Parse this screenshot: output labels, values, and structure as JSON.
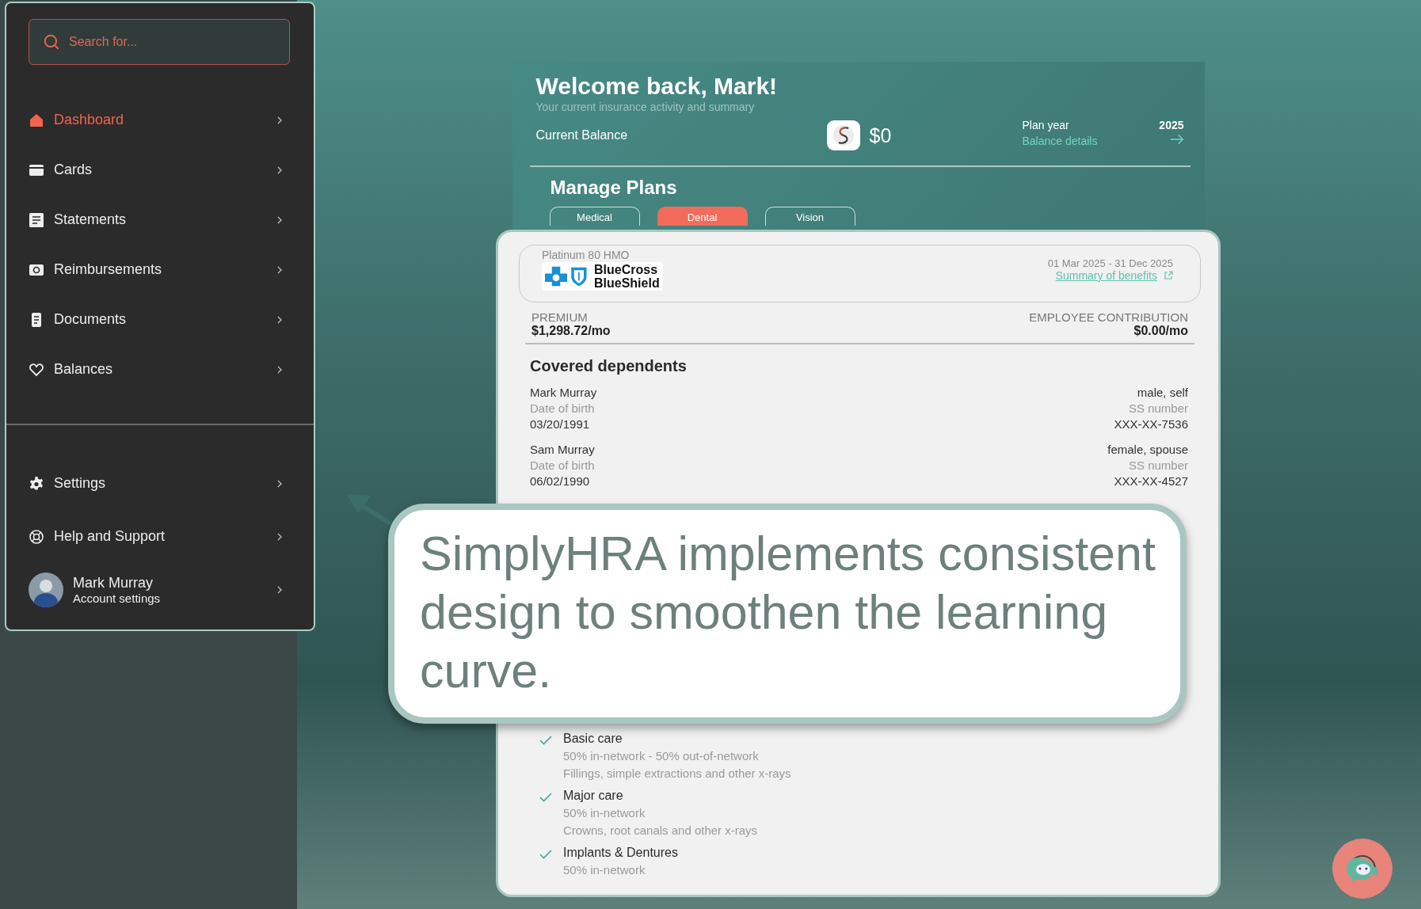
{
  "sidebar": {
    "search": {
      "placeholder": "Search for..."
    },
    "items": [
      {
        "label": "Dashboard",
        "selected": true
      },
      {
        "label": "Cards",
        "selected": false
      },
      {
        "label": "Statements",
        "selected": false
      },
      {
        "label": "Reimbursements",
        "selected": false
      },
      {
        "label": "Documents",
        "selected": false
      },
      {
        "label": "Balances",
        "selected": false
      }
    ],
    "bottom_items": [
      {
        "label": "Settings",
        "selected": false
      },
      {
        "label": "Help and Support",
        "selected": false
      }
    ],
    "user": {
      "name": "Mark Murray",
      "subtitle": "Account settings"
    }
  },
  "header": {
    "title": "Welcome back, Mark!",
    "subtitle": "Your current insurance activity and summary",
    "balance_label": "Current Balance",
    "balance": "$0",
    "plan_year_label": "Plan year",
    "plan_year": "2025",
    "balance_details": "Balance details"
  },
  "manage_plans": {
    "title": "Manage Plans",
    "tabs": [
      {
        "label": "Medical",
        "selected": false
      },
      {
        "label": "Dental",
        "selected": true
      },
      {
        "label": "Vision",
        "selected": false
      }
    ]
  },
  "plan": {
    "name": "Platinum 80 HMO",
    "insurer": [
      "BlueCross",
      "BlueShield"
    ],
    "dates": "01 Mar 2025 - 31 Dec 2025",
    "benefits_link": "Summary of benefits",
    "premium_label": "PREMIUM",
    "premium": "$1,298.72/mo",
    "contribution_label": "EMPLOYEE CONTRIBUTION",
    "contribution": "$0.00/mo"
  },
  "dependents": {
    "title": "Covered dependents",
    "people": [
      {
        "name": "Mark Murray",
        "dob_label": "Date of birth",
        "dob": "03/20/1991",
        "relation": "male, self",
        "ss_label": "SS number",
        "ss": "XXX-XX-7536"
      },
      {
        "name": "Sam Murray",
        "dob_label": "Date of birth",
        "dob": "06/02/1990",
        "relation": "female, spouse",
        "ss_label": "SS number",
        "ss": "XXX-XX-4527"
      }
    ]
  },
  "coverage": [
    {
      "title": "Basic care",
      "checked": true,
      "lines": [
        "50% in-network - 50% out-of-network",
        "Fillings, simple extractions and other x-rays"
      ]
    },
    {
      "title": "Major care",
      "checked": true,
      "lines": [
        "50% in-network",
        "Crowns, root canals and other x-rays"
      ]
    },
    {
      "title": "Implants & Dentures",
      "checked": true,
      "lines": [
        "50% in-network"
      ]
    }
  ],
  "callout": {
    "text": "SimplyHRA implements consistent design to smoothen the learning curve."
  }
}
